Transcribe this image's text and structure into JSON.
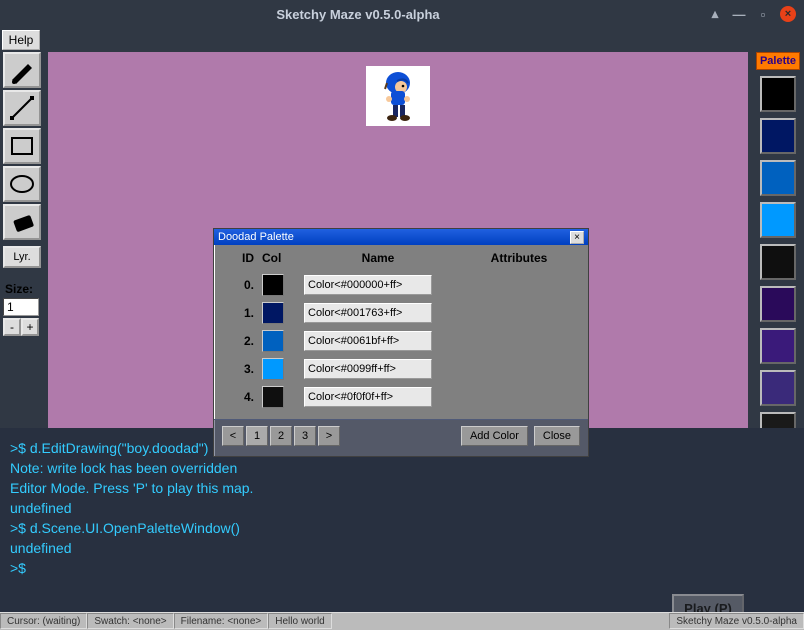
{
  "window": {
    "title": "Sketchy Maze v0.5.0-alpha"
  },
  "menu": {
    "help": "Help"
  },
  "toolbox": {
    "lyr": "Lyr.",
    "size_label": "Size:",
    "size_value": "1",
    "minus": "-",
    "plus": "+"
  },
  "palette_panel": {
    "header": "Palette",
    "swatches": [
      "#000000",
      "#001763",
      "#0061bf",
      "#0099ff",
      "#0f0f0f",
      "#2a0a5a",
      "#3a1a7a",
      "#3a2a7a",
      "#1a1a1a",
      "#2a2a2a",
      "#3a3a3a",
      "#4a4a4a"
    ]
  },
  "dialog": {
    "title": "Doodad Palette",
    "columns": {
      "id": "ID",
      "col": "Col",
      "name": "Name",
      "attr": "Attributes"
    },
    "rows": [
      {
        "id": "0.",
        "color": "#000000",
        "name": "Color<#000000+ff>"
      },
      {
        "id": "1.",
        "color": "#001763",
        "name": "Color<#001763+ff>"
      },
      {
        "id": "2.",
        "color": "#0061bf",
        "name": "Color<#0061bf+ff>"
      },
      {
        "id": "3.",
        "color": "#0099ff",
        "name": "Color<#0099ff+ff>"
      },
      {
        "id": "4.",
        "color": "#0f0f0f",
        "name": "Color<#0f0f0f+ff>"
      }
    ],
    "pager": {
      "prev": "<",
      "p1": "1",
      "p2": "2",
      "p3": "3",
      "next": ">"
    },
    "add": "Add Color",
    "close": "Close"
  },
  "console": {
    "lines": [
      ">$ d.EditDrawing(\"boy.doodad\")",
      "Note: write lock has been overridden",
      "Editor Mode. Press 'P' to play this map.",
      "undefined",
      ">$ d.Scene.UI.OpenPaletteWindow()",
      "undefined",
      ">$"
    ],
    "play": "Play (P)"
  },
  "status": {
    "cursor": "Cursor: (waiting)",
    "swatch": "Swatch: <none>",
    "filename": "Filename: <none>",
    "hello": "Hello world",
    "version": "Sketchy Maze v0.5.0-alpha"
  }
}
